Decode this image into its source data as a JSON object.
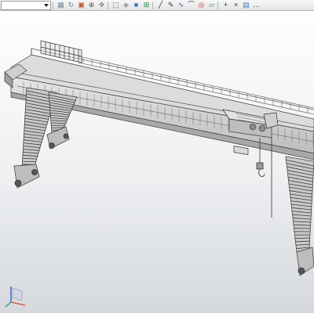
{
  "toolbar": {
    "view_combo_value": "",
    "tools": [
      {
        "name": "display-mode-icon",
        "glyph": "▦",
        "color": "#7a8a9a"
      },
      {
        "name": "rotate-icon",
        "glyph": "↻",
        "color": "#7a8a9a"
      },
      {
        "name": "view-orientation-icon",
        "glyph": "▣",
        "color": "#c0552a"
      },
      {
        "name": "zoom-icon",
        "glyph": "⊕",
        "color": "#555555"
      },
      {
        "name": "pan-icon",
        "glyph": "✥",
        "color": "#7a8a9a"
      },
      {
        "name": "selection-box-icon",
        "glyph": "⬚",
        "color": "#333333"
      },
      {
        "name": "cube-view-icon",
        "glyph": "◈",
        "color": "#888888"
      },
      {
        "name": "shaded-cube-icon",
        "glyph": "■",
        "color": "#3a78c2"
      },
      {
        "name": "grid-icon",
        "glyph": "⊞",
        "color": "#2b8a4a"
      },
      {
        "name": "line-icon",
        "glyph": "╱",
        "color": "#333333"
      },
      {
        "name": "sketch-icon",
        "glyph": "✎",
        "color": "#333333"
      },
      {
        "name": "curve-icon",
        "glyph": "∿",
        "color": "#7a3aa8"
      },
      {
        "name": "arc-icon",
        "glyph": "⌒",
        "color": "#333333"
      },
      {
        "name": "target-icon",
        "glyph": "◎",
        "color": "#c0302a"
      },
      {
        "name": "plane-icon",
        "glyph": "▱",
        "color": "#2b8a4a"
      },
      {
        "name": "crosshair-icon",
        "glyph": "+",
        "color": "#333333"
      },
      {
        "name": "cross-icon",
        "glyph": "×",
        "color": "#333333"
      },
      {
        "name": "document-icon",
        "glyph": "▤",
        "color": "#3a78c2"
      },
      {
        "name": "more-icon",
        "glyph": "…",
        "color": "#333333"
      }
    ]
  },
  "triad": {
    "x_color": "#d24a3a",
    "y_color": "#3aa84a",
    "z_color": "#3a5ad2"
  }
}
